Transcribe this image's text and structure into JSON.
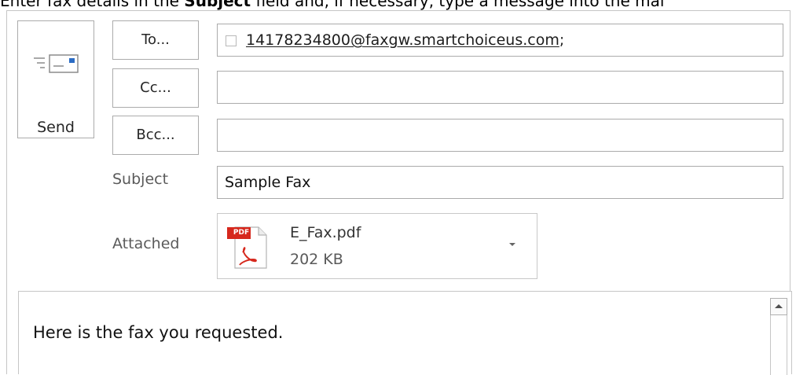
{
  "instruction": {
    "before": "Enter fax details in the ",
    "bold": "Subject",
    "after": " field and, if necessary, type a message into the mai"
  },
  "send": {
    "label": "Send",
    "icon": "send-envelope-icon"
  },
  "address_buttons": {
    "to": "To...",
    "cc": "Cc...",
    "bcc": "Bcc..."
  },
  "fields": {
    "to_value": "14178234800@faxgw.smartchoiceus.com",
    "to_separator": ";",
    "cc_value": "",
    "bcc_value": ""
  },
  "subject": {
    "label": "Subject",
    "value": "Sample Fax"
  },
  "attached": {
    "label": "Attached",
    "file_name": "E_Fax.pdf",
    "file_size": "202 KB",
    "file_icon": "pdf-file-icon",
    "pdf_badge": "PDF"
  },
  "message": {
    "text": "Here is the fax you requested."
  },
  "colors": {
    "pdf_red": "#d6281d",
    "border": "#ababab"
  }
}
